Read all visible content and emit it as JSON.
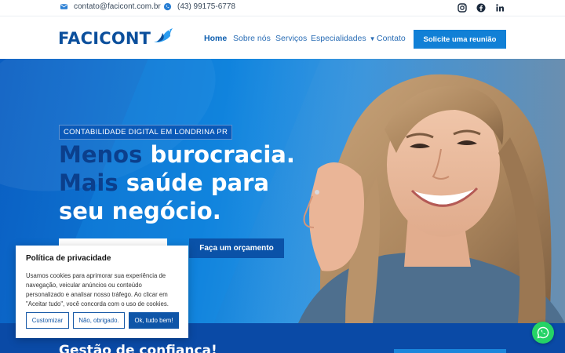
{
  "topbar": {
    "email": "contato@facicont.com.br",
    "phone": "(43) 99175-6778",
    "icons": [
      "envelope-icon",
      "whatsapp-icon",
      "instagram-icon",
      "facebook-icon",
      "linkedin-icon"
    ]
  },
  "header": {
    "logo_text": "FACICONT",
    "nav": [
      {
        "label": "Home"
      },
      {
        "label": "Sobre nós"
      },
      {
        "label": "Serviços"
      },
      {
        "label": "Especialidades"
      },
      {
        "label": "Contato"
      }
    ],
    "cta": "Solicite uma reunião"
  },
  "hero": {
    "badge": "CONTABILIDADE DIGITAL EM LONDRINA PR",
    "headline_dark1": "Menos",
    "headline_light1": " burocracia.",
    "headline_dark2": "Mais",
    "headline_light2": " saúde para",
    "headline_light3": "seu negócio.",
    "button_blue": "Faça um orçamento"
  },
  "lower": {
    "title_start": "Gestão de ",
    "title_accent": "confiança!"
  },
  "cookie": {
    "title": "Política de privacidade",
    "text": "Usamos cookies para aprimorar sua experiência de navegação, veicular anúncios ou conteúdo personalizado e analisar nosso tráfego. Ao clicar em \"Aceitar tudo\", você concorda com o uso de cookies.",
    "btn_customize": "Customizar",
    "btn_decline": "Não, obrigado.",
    "btn_accept": "Ok, tudo bem!"
  },
  "colors": {
    "brand": "#0b4f9c",
    "accent": "#1180d6",
    "whatsapp": "#25d366"
  }
}
